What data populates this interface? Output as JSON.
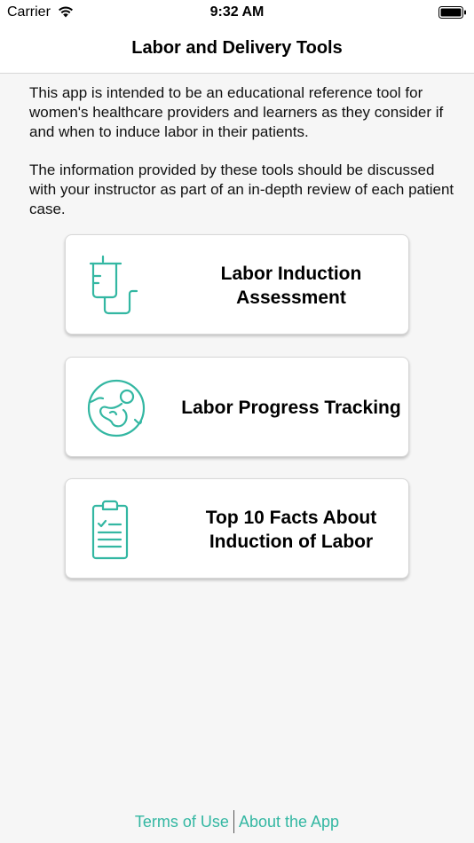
{
  "status_bar": {
    "carrier": "Carrier",
    "time": "9:32 AM"
  },
  "nav": {
    "title": "Labor and Delivery Tools"
  },
  "intro": {
    "paragraph_1": "This app is intended to be an educational reference tool for women's healthcare providers and learners as they consider if and when to induce labor in their patients.",
    "paragraph_2": "The information provided by these tools should be discussed with your instructor as part of an in-depth review of each patient case."
  },
  "cards": [
    {
      "label": "Labor Induction Assessment",
      "icon": "iv-drip-icon"
    },
    {
      "label": "Labor Progress Tracking",
      "icon": "fetus-icon"
    },
    {
      "label": "Top 10 Facts About Induction of Labor",
      "icon": "clipboard-checklist-icon"
    }
  ],
  "footer": {
    "terms_label": "Terms of Use",
    "about_label": "About the App"
  },
  "colors": {
    "accent": "#33b7a2",
    "background": "#f6f6f6",
    "card": "#ffffff"
  }
}
